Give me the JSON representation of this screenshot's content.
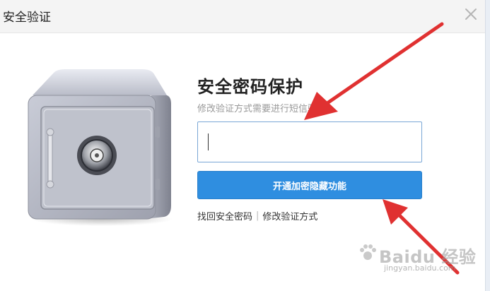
{
  "dialog": {
    "title": "安全验证"
  },
  "content": {
    "heading": "安全密码保护",
    "subtext": "修改验证方式需要进行短信验证",
    "password_value": "",
    "primary_button": "开通加密隐藏功能",
    "link_retrieve": "找回安全密码",
    "link_separator": "|",
    "link_modify": "修改验证方式"
  },
  "watermark": {
    "brand": "Baidu 经验",
    "url": "jingyan.baidu.com"
  },
  "colors": {
    "accent": "#2f8ee0",
    "arrow": "#e03131",
    "title_bar": "#f4f4f4"
  },
  "icons": [
    "close-icon",
    "safe-illustration",
    "arrow-annotation",
    "paw-logo"
  ]
}
